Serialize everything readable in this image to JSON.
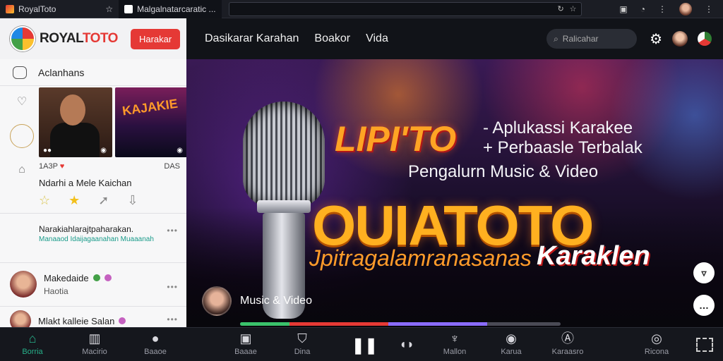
{
  "browser": {
    "tab1_title": "RoyalToto",
    "tab2_title": "Malgalnatarcaratic ...",
    "address_icons": [
      "reload-icon",
      "star-icon"
    ]
  },
  "header": {
    "logo_text_black": "ROYAL",
    "logo_text_red": "TOTO",
    "login_label": "Harakar",
    "nav": [
      "Dasikarar Karahan",
      "Boakor",
      "Vida"
    ],
    "search_placeholder": "Ralicahar"
  },
  "sidebar": {
    "head_label": "Aclanhans",
    "thumb2_text": "KAJAKIE",
    "meta_left": "1A3P",
    "meta_right": "DAS",
    "song_title": "Ndarhi a Mele Kaichan",
    "lyric_title": "Narakiahlarajtpaharakan.",
    "lyric_sub": "Manaaod Idaijagaanahan Muaaanah",
    "users": [
      {
        "name": "Makedaide",
        "sub": "Haotia"
      },
      {
        "name": "Mlakt kalleie Salan",
        "sub": ""
      }
    ]
  },
  "hero": {
    "brand": "LIPI'TO",
    "tagline_line1": "- Aplukassi Karakee",
    "tagline_line2": "+ Perbaasle Terbalak",
    "subtitle": "Pengalurn Music & Video",
    "big_title": "OUIATOTO",
    "strip_text": "Jpitragalamranasanas",
    "kara_text": "Karaklen",
    "user_label": "Music & Video",
    "progress": 0.77
  },
  "bottombar": {
    "left_items": [
      "Borria",
      "Macirio",
      "Baaoe"
    ],
    "right_items": [
      "Baaae",
      "Dina",
      "Mallon",
      "Karua",
      "Karaasro",
      "Ricona"
    ]
  },
  "colors": {
    "accent": "#e53935",
    "active_nav": "#27b08a",
    "hero_gold": "#ffb020"
  }
}
